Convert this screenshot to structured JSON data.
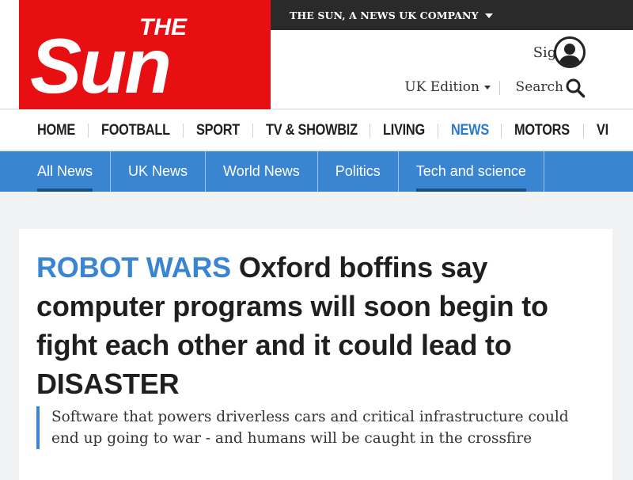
{
  "topbar": {
    "company_label": "THE SUN, A NEWS UK COMPANY"
  },
  "logo": {
    "line1": "THE",
    "line2": "Sun"
  },
  "account": {
    "signin_label": "Sign in"
  },
  "edition": {
    "label": "UK Edition"
  },
  "search": {
    "label": "Search"
  },
  "main_nav": {
    "items": [
      {
        "label": "HOME"
      },
      {
        "label": "FOOTBALL"
      },
      {
        "label": "SPORT"
      },
      {
        "label": "TV & SHOWBIZ"
      },
      {
        "label": "LIVING"
      },
      {
        "label": "NEWS"
      },
      {
        "label": "MOTORS"
      },
      {
        "label": "VI"
      }
    ],
    "active_index": 5
  },
  "sub_nav": {
    "items": [
      {
        "label": "All News"
      },
      {
        "label": "UK News"
      },
      {
        "label": "World News"
      },
      {
        "label": "Politics"
      },
      {
        "label": "Tech and science"
      }
    ]
  },
  "article": {
    "kicker": "ROBOT WARS",
    "headline": "Oxford boffins say computer programs will soon begin to fight each other and it could lead to DISASTER",
    "standfirst": "Software that powers driverless cars and critical infrastructure could end up going to war - and humans will be caught in the crossfire"
  },
  "colors": {
    "brand_red": "#e70f12",
    "news_blue": "#3a85d1",
    "topbar_dark": "#2a2a2a"
  }
}
